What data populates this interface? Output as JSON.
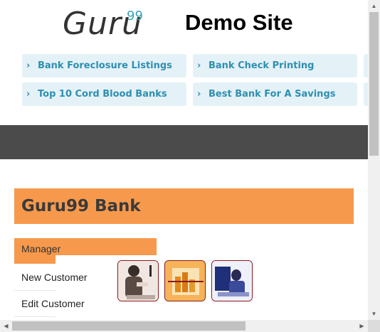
{
  "header": {
    "logo_text": "Guru",
    "logo_sup": "99",
    "site_title": "Demo Site"
  },
  "ads": [
    {
      "label": "Bank Foreclosure Listings"
    },
    {
      "label": "Bank Check Printing"
    },
    {
      "label": "Top 10 Cord Blood Banks"
    },
    {
      "label": "Best Bank For A Savings"
    }
  ],
  "bank": {
    "title": "Guru99 Bank"
  },
  "menu": {
    "manager": "Manager",
    "items": [
      "New Customer",
      "Edit Customer"
    ]
  },
  "colors": {
    "accent": "#f7994c",
    "ad_bg": "#e4f2f8",
    "ad_text": "#2e8fb0",
    "navbar": "#4b4b4b"
  }
}
